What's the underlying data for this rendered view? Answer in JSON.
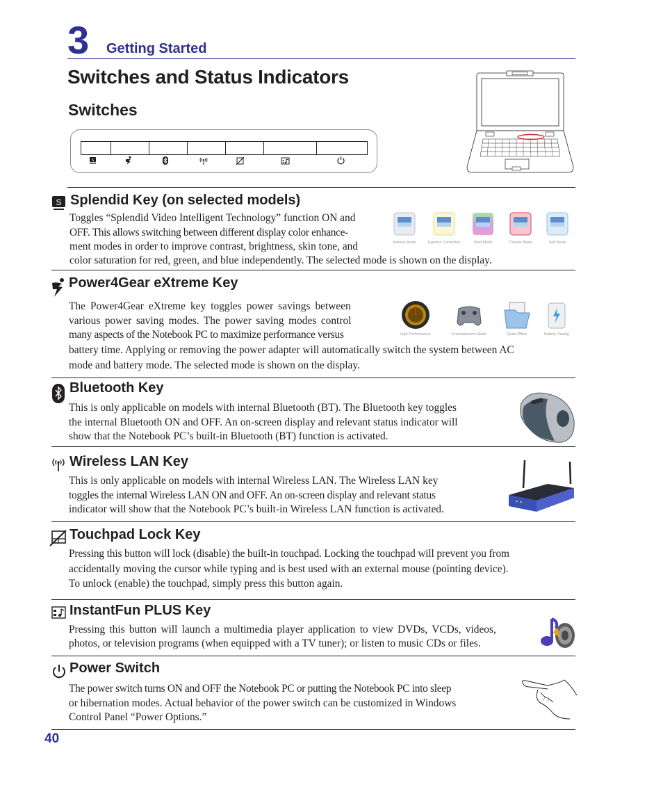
{
  "header": {
    "chapter_number": "3",
    "chapter_title": "Getting Started",
    "page_title": "Switches and Status Indicators",
    "subtitle": "Switches"
  },
  "key_panel": {
    "keys": [
      {
        "icon": "splendid-icon"
      },
      {
        "icon": "power4gear-icon"
      },
      {
        "icon": "bluetooth-icon"
      },
      {
        "icon": "wireless-icon"
      },
      {
        "icon": "touchpad-lock-icon"
      },
      {
        "icon": "instantfun-icon"
      },
      {
        "icon": "power-icon"
      }
    ]
  },
  "sections": [
    {
      "title": "Splendid Key (on selected models)",
      "icon": "splendid-icon",
      "paragraph_lines": [
        "Toggles “Splendid Video Intelligent Technology” function ON and",
        "OFF. This allows switching between different display color enhance-",
        "ment modes in order to improve contrast, brightness, skin tone, and",
        "color saturation for red, green, and blue independently. The selected mode is shown on the display."
      ],
      "image_captions": [
        "Normal Mode",
        "Gamma Correction",
        "Vivid Mode",
        "Theater Mode",
        "Soft Mode"
      ]
    },
    {
      "title": "Power4Gear eXtreme Key",
      "icon": "power4gear-icon",
      "paragraph_lines": [
        "The Power4Gear eXtreme key toggles power savings between",
        "various power saving modes. The power saving modes control",
        "many aspects of the Notebook PC to maximize performance versus",
        "battery time. Applying or removing the power adapter will automatically switch the system between AC",
        "mode and battery mode. The selected mode is shown on the display."
      ],
      "image_captions": [
        "High Performance",
        "Entertainment Mode",
        "Quiet Office",
        "Battery Saving"
      ]
    },
    {
      "title": "Bluetooth Key",
      "icon": "bluetooth-icon",
      "paragraph_lines": [
        "This is only applicable on models with internal Bluetooth (BT). The Bluetooth key toggles",
        "the internal Bluetooth ON and OFF. An on-screen display and relevant status indicator will",
        "show that the Notebook PC’s built-in Bluetooth (BT) function is activated."
      ]
    },
    {
      "title": "Wireless LAN Key",
      "icon": "wireless-icon",
      "paragraph_lines": [
        "This is only applicable on models with internal Wireless LAN. The Wireless LAN key",
        "toggles the internal Wireless LAN ON and OFF. An on-screen display and relevant status",
        "indicator will show that the Notebook PC’s built-in Wireless LAN function is activated."
      ]
    },
    {
      "title": "Touchpad Lock Key",
      "icon": "touchpad-lock-icon",
      "paragraph_lines": [
        "Pressing this button will lock (disable) the built-in touchpad. Locking the touchpad will prevent you from",
        "accidentally moving the cursor while typing and is best used with an external mouse (pointing device).",
        "To unlock (enable) the touchpad, simply press this button again."
      ]
    },
    {
      "title": "InstantFun PLUS Key",
      "icon": "instantfun-icon",
      "paragraph_lines": [
        "Pressing this button will launch a multimedia player application to view DVDs, VCDs, videos,",
        "photos, or television programs (when equipped with a TV tuner); or listen to music CDs or files."
      ]
    },
    {
      "title": "Power Switch",
      "icon": "power-icon",
      "paragraph_lines": [
        "The power switch turns ON and OFF the Notebook PC or putting the Notebook PC into sleep",
        "or hibernation modes. Actual behavior of the power switch can be customized in Windows",
        "Control Panel “Power Options.”"
      ]
    }
  ],
  "footer": {
    "page_number": "40"
  },
  "colors": {
    "accent": "#2e3192",
    "text": "#231f20",
    "highlight": "#d9232d"
  }
}
